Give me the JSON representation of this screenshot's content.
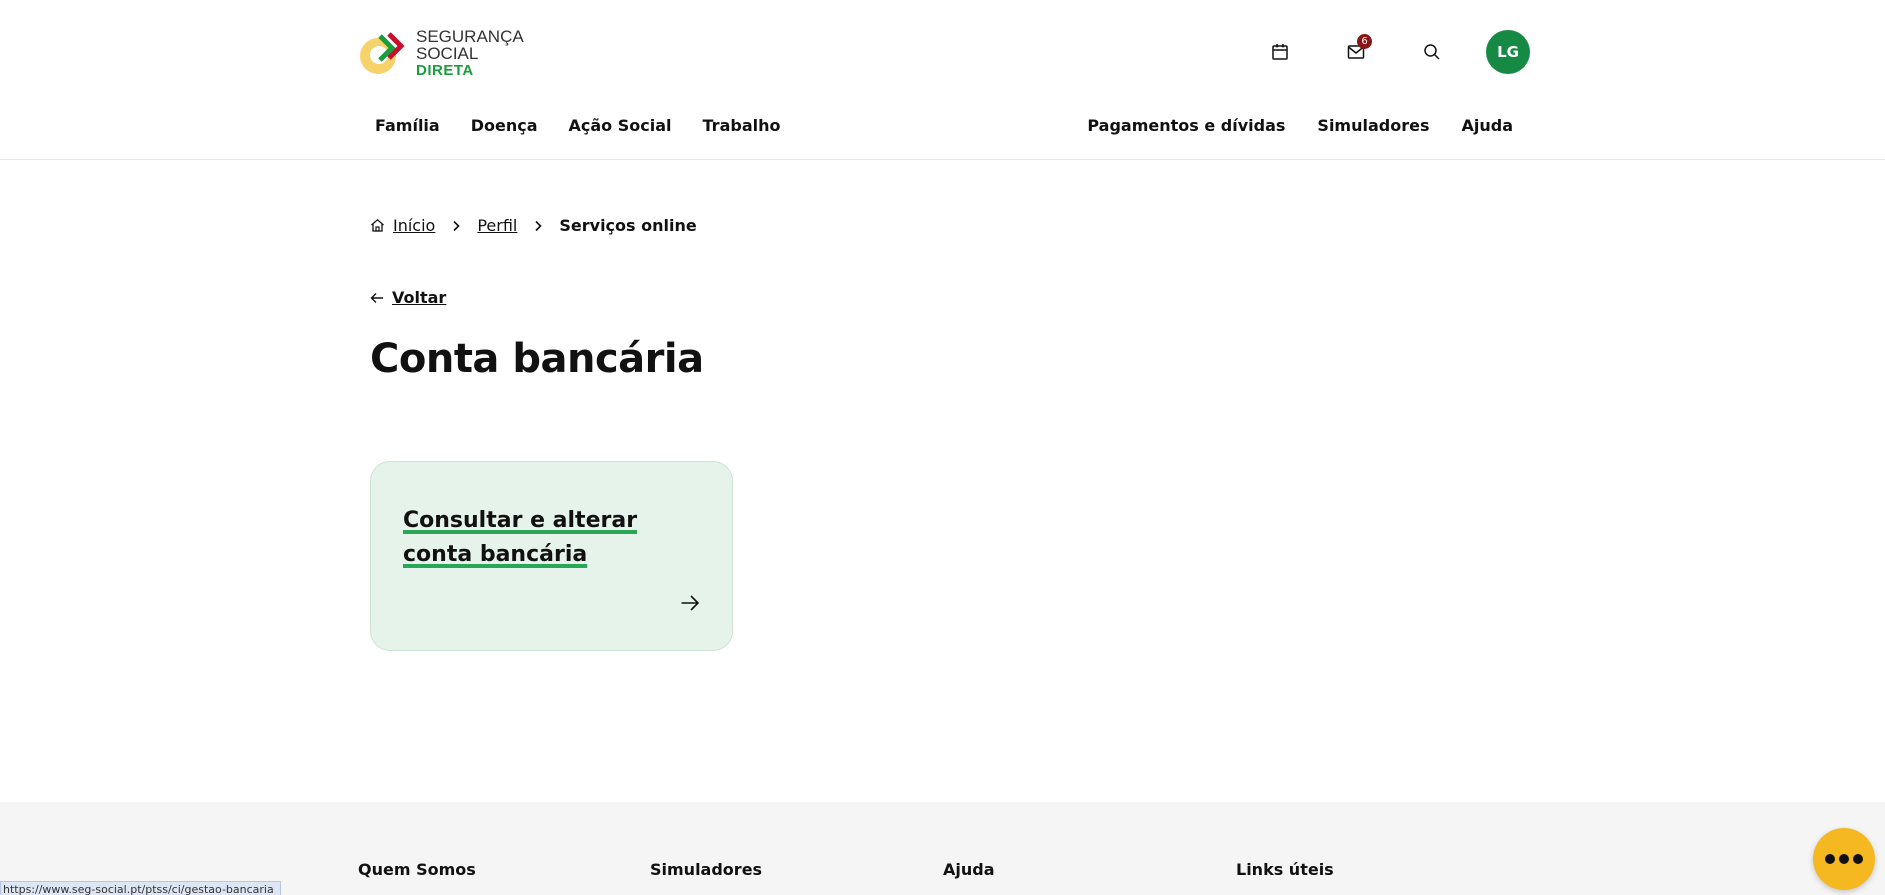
{
  "header": {
    "logo": {
      "line1": "SEGURANÇA SOCIAL",
      "line2": "DIRETA"
    },
    "icons": {
      "calendar": "calendar-icon",
      "mail": "mail-icon",
      "search": "search-icon"
    },
    "mail_badge": "6",
    "avatar_initials": "LG",
    "nav_left": [
      "Família",
      "Doença",
      "Ação Social",
      "Trabalho"
    ],
    "nav_right": [
      "Pagamentos e dívidas",
      "Simuladores",
      "Ajuda"
    ]
  },
  "breadcrumb": {
    "home": "Início",
    "profile": "Perfil",
    "current": "Serviços online"
  },
  "back_label": "Voltar",
  "page_title": "Conta bancária",
  "card": {
    "title": "Consultar e alterar conta bancária"
  },
  "footer": {
    "columns": [
      "Quem Somos",
      "Simuladores",
      "Ajuda",
      "Links úteis"
    ]
  },
  "status_url": "https://www.seg-social.pt/ptss/ci/gestao-bancaria",
  "colors": {
    "brand_green": "#168a44",
    "card_bg": "#e6f3ea",
    "badge": "#8b1414",
    "chat": "#f5b820"
  }
}
